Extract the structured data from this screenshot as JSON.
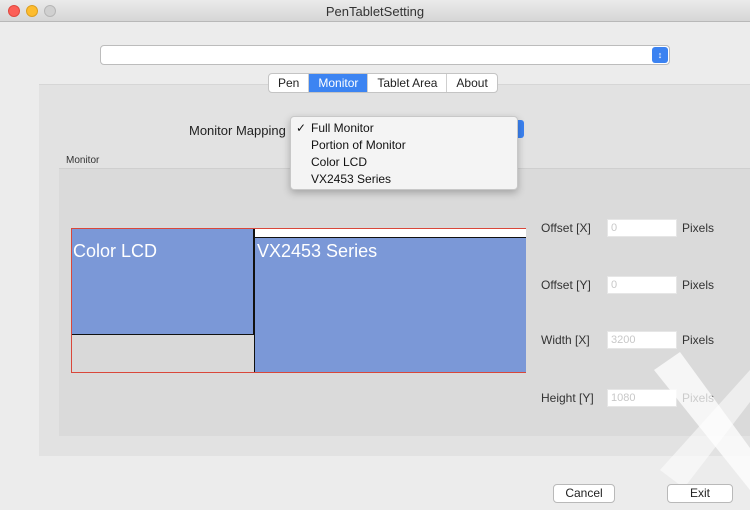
{
  "window": {
    "title": "PenTabletSetting"
  },
  "device_select": {
    "value": "",
    "arrow_icon": "up-down-arrows-icon"
  },
  "tabs": [
    {
      "label": "Pen",
      "active": false
    },
    {
      "label": "Monitor",
      "active": true
    },
    {
      "label": "Tablet Area",
      "active": false
    },
    {
      "label": "About",
      "active": false
    }
  ],
  "monitor_mapping": {
    "label": "Monitor Mapping",
    "options": [
      {
        "label": "Full Monitor",
        "checked": true
      },
      {
        "label": "Portion of Monitor",
        "checked": false
      },
      {
        "label": "Color LCD",
        "checked": false
      },
      {
        "label": "VX2453 Series",
        "checked": false
      }
    ]
  },
  "monitor_group": {
    "label": "Monitor"
  },
  "monitors": [
    {
      "name": "Color LCD"
    },
    {
      "name": "VX2453 Series"
    }
  ],
  "fields": {
    "offset_x": {
      "label": "Offset [X]",
      "placeholder": "0",
      "unit": "Pixels"
    },
    "offset_y": {
      "label": "Offset [Y]",
      "placeholder": "0",
      "unit": "Pixels"
    },
    "width_x": {
      "label": "Width [X]",
      "placeholder": "3200",
      "unit": "Pixels"
    },
    "height_y": {
      "label": "Height [Y]",
      "placeholder": "1080",
      "unit": "Pixels"
    }
  },
  "buttons": {
    "cancel": "Cancel",
    "exit": "Exit"
  },
  "colors": {
    "accent": "#3c84f2",
    "monitor_fill": "#7b98d7",
    "mapping_border": "#d9473a"
  }
}
